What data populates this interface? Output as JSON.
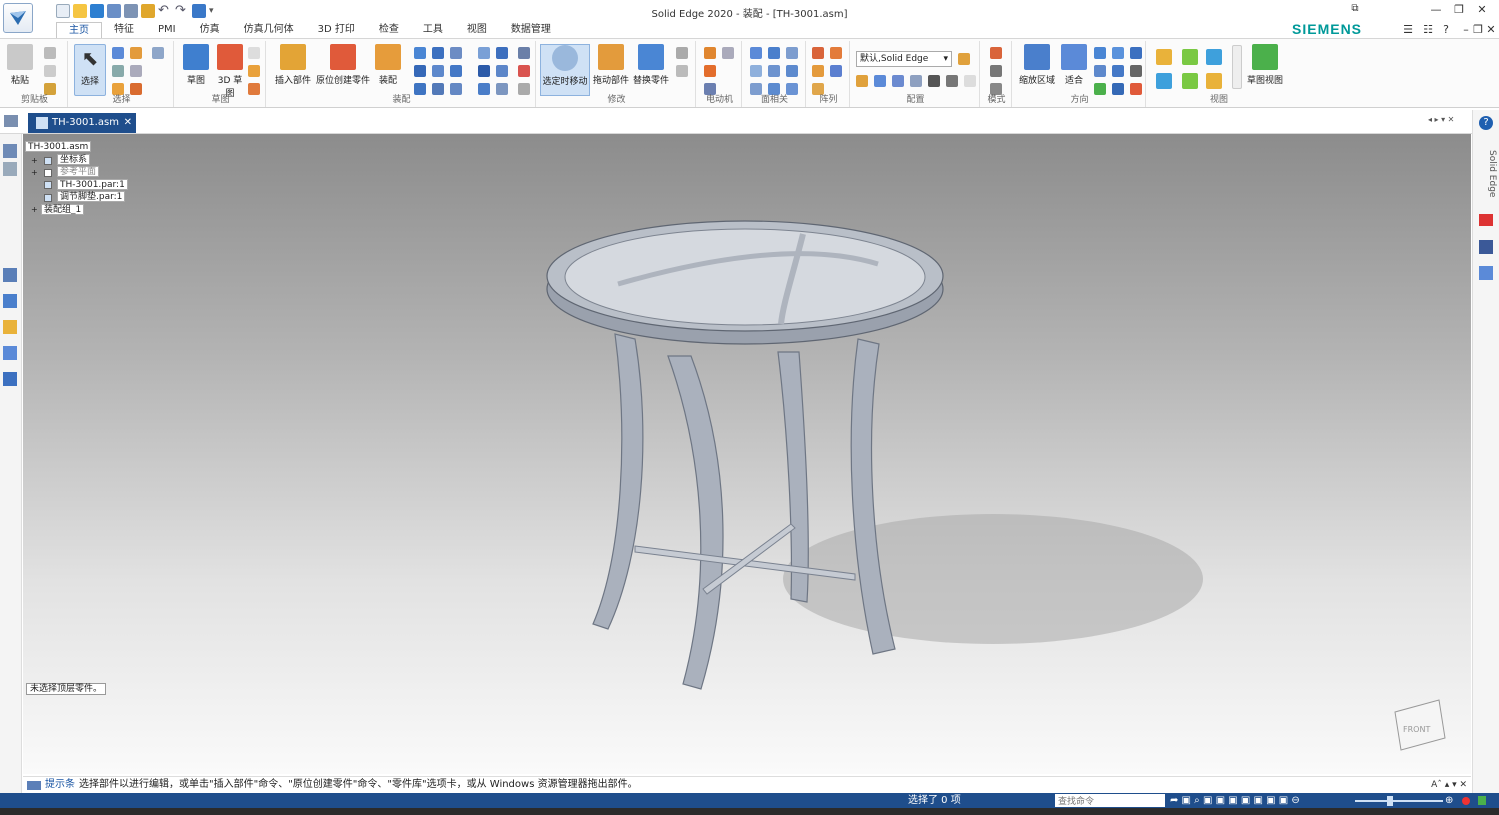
{
  "app": {
    "title": "Solid Edge 2020 - 装配 - [TH-3001.asm]",
    "brand": "SIEMENS"
  },
  "tabs": [
    "主页",
    "特征",
    "PMI",
    "仿真",
    "仿真几何体",
    "3D 打印",
    "检查",
    "工具",
    "视图",
    "数据管理"
  ],
  "active_tab": "主页",
  "ribbon": {
    "clipboard": {
      "paste": "粘贴",
      "group": "剪贴板"
    },
    "select": {
      "button": "选择",
      "group": "选择"
    },
    "sketch": {
      "draw": "草图",
      "sketch3d": "3D 草图",
      "group": "草图"
    },
    "assemble": {
      "insert": "插入部件",
      "create": "原位创建零件",
      "assemble": "装配",
      "group": "装配"
    },
    "modify": {
      "select_move": "选定时移动",
      "drag": "拖动部件",
      "replace": "替换零件",
      "group": "修改"
    },
    "motor": {
      "group": "电动机"
    },
    "face": {
      "group": "面相关"
    },
    "pattern": {
      "group": "阵列"
    },
    "config": {
      "dropdown": "默认,Solid Edge",
      "group": "配置"
    },
    "style": {
      "group": "模式"
    },
    "orient": {
      "zoom_area": "缩放区域",
      "fit": "适合",
      "group": "方向"
    },
    "views": {
      "sketch_view": "草图视图",
      "group": "视图"
    }
  },
  "document": {
    "tab": "TH-3001.asm"
  },
  "tree": [
    {
      "label": "TH-3001.asm",
      "checked": false
    },
    {
      "label": "坐标系",
      "checked": true
    },
    {
      "label": "参考平面",
      "checked": false
    },
    {
      "label": "TH-3001.par:1",
      "checked": true
    },
    {
      "label": "调节脚垫.par:1",
      "checked": true
    },
    {
      "label": "装配组_1",
      "checked": false
    }
  ],
  "viewport": {
    "note": "未选择顶层零件。",
    "cube_face": "FRONT"
  },
  "cmdbar": {
    "label": "提示条",
    "prompt": "选择部件以进行编辑，或单击\"插入部件\"命令、\"原位创建零件\"命令、\"零件库\"选项卡，或从 Windows 资源管理器拖出部件。"
  },
  "statusbar": {
    "selected": "选择了 0 项",
    "search_placeholder": "查找命令"
  },
  "right_sidebar": {
    "label": "Solid Edge"
  }
}
